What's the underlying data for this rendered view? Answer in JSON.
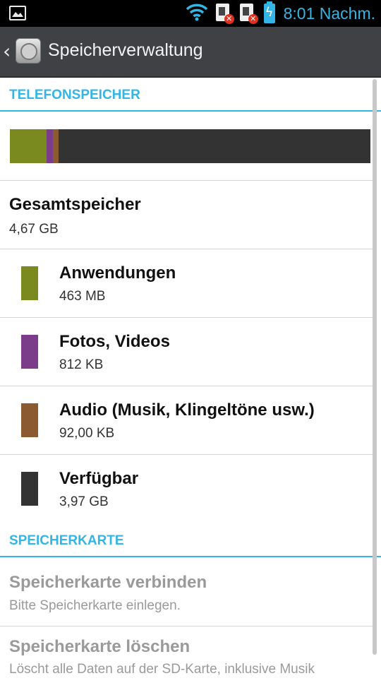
{
  "status_bar": {
    "time": "8:01 Nachm.",
    "icons": [
      "gallery-icon",
      "wifi-icon",
      "sim-1-error-icon",
      "sim-2-error-icon",
      "battery-charging-icon"
    ],
    "accent_color": "#33b5e5"
  },
  "action_bar": {
    "title": "Speicherverwaltung",
    "icons": [
      "back-chevron-icon",
      "storage-app-icon"
    ]
  },
  "phone_storage": {
    "header": "TELEFONSPEICHER",
    "usage_bar": [
      {
        "name": "apps",
        "color": "#7a8a1e",
        "fraction": 0.102
      },
      {
        "name": "photos",
        "color": "#7b3c8a",
        "fraction": 0.018
      },
      {
        "name": "audio",
        "color": "#8b5a30",
        "fraction": 0.016
      },
      {
        "name": "free",
        "color": "#333333",
        "fraction": 0.864
      }
    ],
    "total": {
      "title": "Gesamtspeicher",
      "value": "4,67 GB"
    },
    "items": [
      {
        "title": "Anwendungen",
        "value": "463 MB",
        "color": "#7a8a1e"
      },
      {
        "title": "Fotos, Videos",
        "value": "812 KB",
        "color": "#7b3c8a"
      },
      {
        "title": "Audio (Musik, Klingeltöne usw.)",
        "value": "92,00 KB",
        "color": "#8b5a30"
      },
      {
        "title": "Verfügbar",
        "value": "3,97 GB",
        "color": "#333333"
      }
    ]
  },
  "sd_card": {
    "header": "SPEICHERKARTE",
    "items": [
      {
        "title": "Speicherkarte verbinden",
        "subtitle": "Bitte Speicherkarte einlegen."
      },
      {
        "title": "Speicherkarte löschen",
        "subtitle": "Löscht alle Daten auf der SD-Karte, inklusive Musik"
      }
    ]
  }
}
